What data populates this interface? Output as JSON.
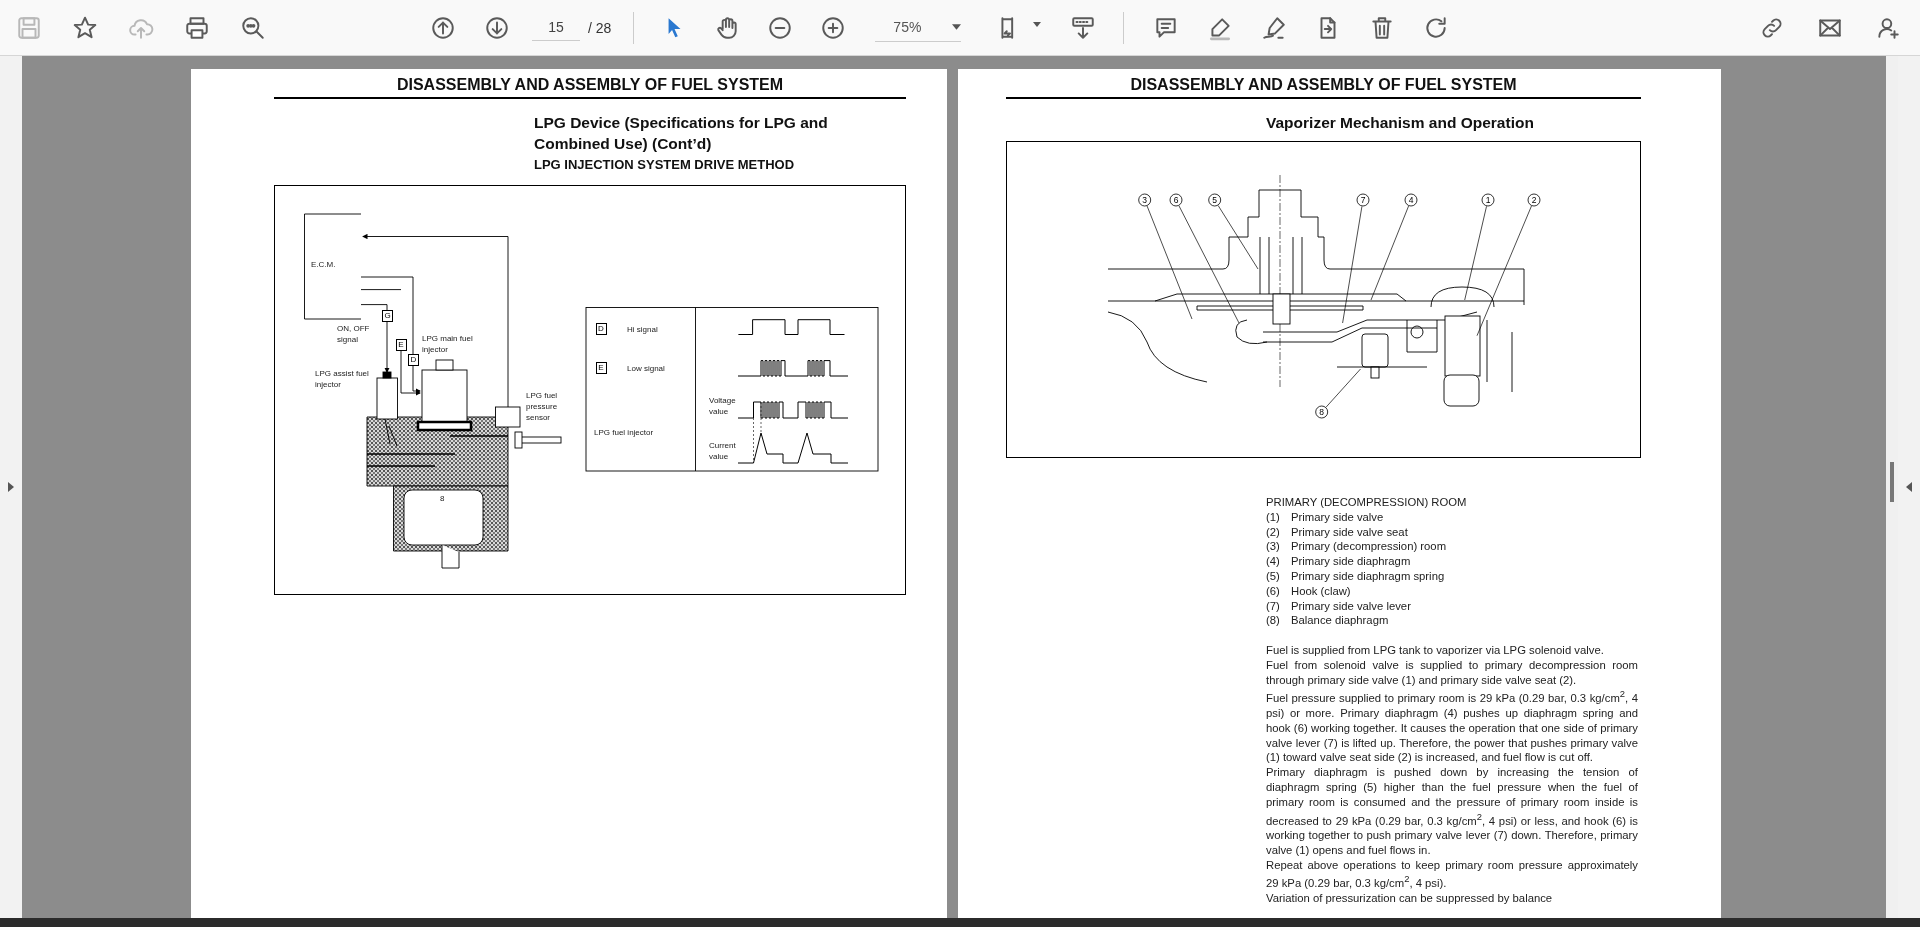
{
  "toolbar": {
    "file_tools": [
      {
        "kind": "save",
        "disabled": true
      },
      {
        "kind": "bookmark",
        "disabled": false
      },
      {
        "kind": "upload",
        "disabled": true
      },
      {
        "kind": "print",
        "disabled": false
      },
      {
        "kind": "find",
        "disabled": false
      }
    ],
    "nav_tools": [
      {
        "kind": "page-up"
      },
      {
        "kind": "page-down"
      }
    ],
    "page_number": "15",
    "page_count": "/ 28",
    "view_tools": [
      {
        "kind": "select",
        "selected": true
      },
      {
        "kind": "hand",
        "selected": false
      },
      {
        "kind": "zoom-out",
        "selected": false
      },
      {
        "kind": "zoom-in",
        "selected": false
      }
    ],
    "zoom": "75%",
    "page_tools": [
      {
        "kind": "fit-page"
      },
      {
        "kind": "scroll-mode"
      }
    ],
    "edit_tools": [
      {
        "kind": "comment"
      },
      {
        "kind": "highlight"
      },
      {
        "kind": "sign"
      },
      {
        "kind": "export"
      },
      {
        "kind": "delete"
      },
      {
        "kind": "rotate"
      }
    ],
    "share_tools": [
      {
        "kind": "link"
      },
      {
        "kind": "email"
      },
      {
        "kind": "add-user"
      }
    ]
  },
  "left_page": {
    "header": "DISASSEMBLY AND ASSEMBLY OF FUEL SYSTEM",
    "title": "LPG Device (Specifications for LPG and Combined Use) (Cont’d)",
    "subtitle": "LPG INJECTION SYSTEM DRIVE METHOD",
    "figure": {
      "labels": [
        {
          "kind": "ecm",
          "text": "E.C.M."
        },
        {
          "kind": "on-off",
          "text": "ON, OFF signal"
        },
        {
          "kind": "main-injector",
          "text": "LPG main fuel injector"
        },
        {
          "kind": "assist-injector",
          "text": "LPG assist fuel injector"
        },
        {
          "kind": "pressure-sensor",
          "text": "LPG fuel pressure sensor"
        },
        {
          "kind": "port",
          "text": "8"
        }
      ],
      "signal_markers": [
        "G",
        "E",
        "D"
      ],
      "legend": [
        {
          "mark": "D",
          "text": "Hi signal"
        },
        {
          "mark": "E",
          "text": "Low signal"
        }
      ],
      "injector_label": "LPG fuel injector",
      "voltage_label": "Voltage value",
      "current_label": "Current value"
    }
  },
  "right_page": {
    "header": "DISASSEMBLY AND ASSEMBLY OF FUEL SYSTEM",
    "title": "Vaporizer Mechanism and Operation",
    "figure": {
      "callouts": [
        "3",
        "6",
        "5",
        "7",
        "4",
        "1",
        "2",
        "8"
      ]
    },
    "parts_heading": "PRIMARY (DECOMPRESSION) ROOM",
    "parts": [
      {
        "number": "(1)",
        "name": "Primary side valve"
      },
      {
        "number": "(2)",
        "name": "Primary side valve seat"
      },
      {
        "number": "(3)",
        "name": "Primary (decompression) room"
      },
      {
        "number": "(4)",
        "name": "Primary side diaphragm"
      },
      {
        "number": "(5)",
        "name": "Primary side diaphragm spring"
      },
      {
        "number": "(6)",
        "name": "Hook (claw)"
      },
      {
        "number": "(7)",
        "name": "Primary side valve lever"
      },
      {
        "number": "(8)",
        "name": "Balance diaphragm"
      }
    ],
    "paragraphs": [
      "Fuel is supplied from LPG tank to vaporizer via LPG solenoid valve.",
      "Fuel from solenoid valve is supplied to primary decompression room through primary side valve (1) and primary side valve seat (2).",
      "Fuel pressure supplied to primary room is 29 kPa (0.29 bar, 0.3 kg/cm$^{2}$, 4 psi) or more. Primary diaphragm (4) pushes up diaphragm spring and hook (6) working together. It causes the operation that one side of primary valve lever (7) is lifted up. Therefore, the power that pushes primary valve (1) toward valve seat side (2) is increased, and fuel flow is cut off.",
      "Primary diaphragm is pushed down by increasing the tension of diaphragm spring (5) higher than the fuel pressure when the fuel of primary room is consumed and the pressure of primary room inside is decreased to 29 kPa (0.29 bar, 0.3 kg/cm$^{2}$, 4 psi) or less, and hook (6) is working together to push primary valve lever (7) down. Therefore, primary valve (1) opens and fuel flows in.",
      "Repeat above operations to keep primary room pressure approximately 29 kPa (0.29 bar, 0.3 kg/cm$^{2}$, 4 psi).",
      "Variation of pressurization can be suppressed by balance"
    ]
  }
}
